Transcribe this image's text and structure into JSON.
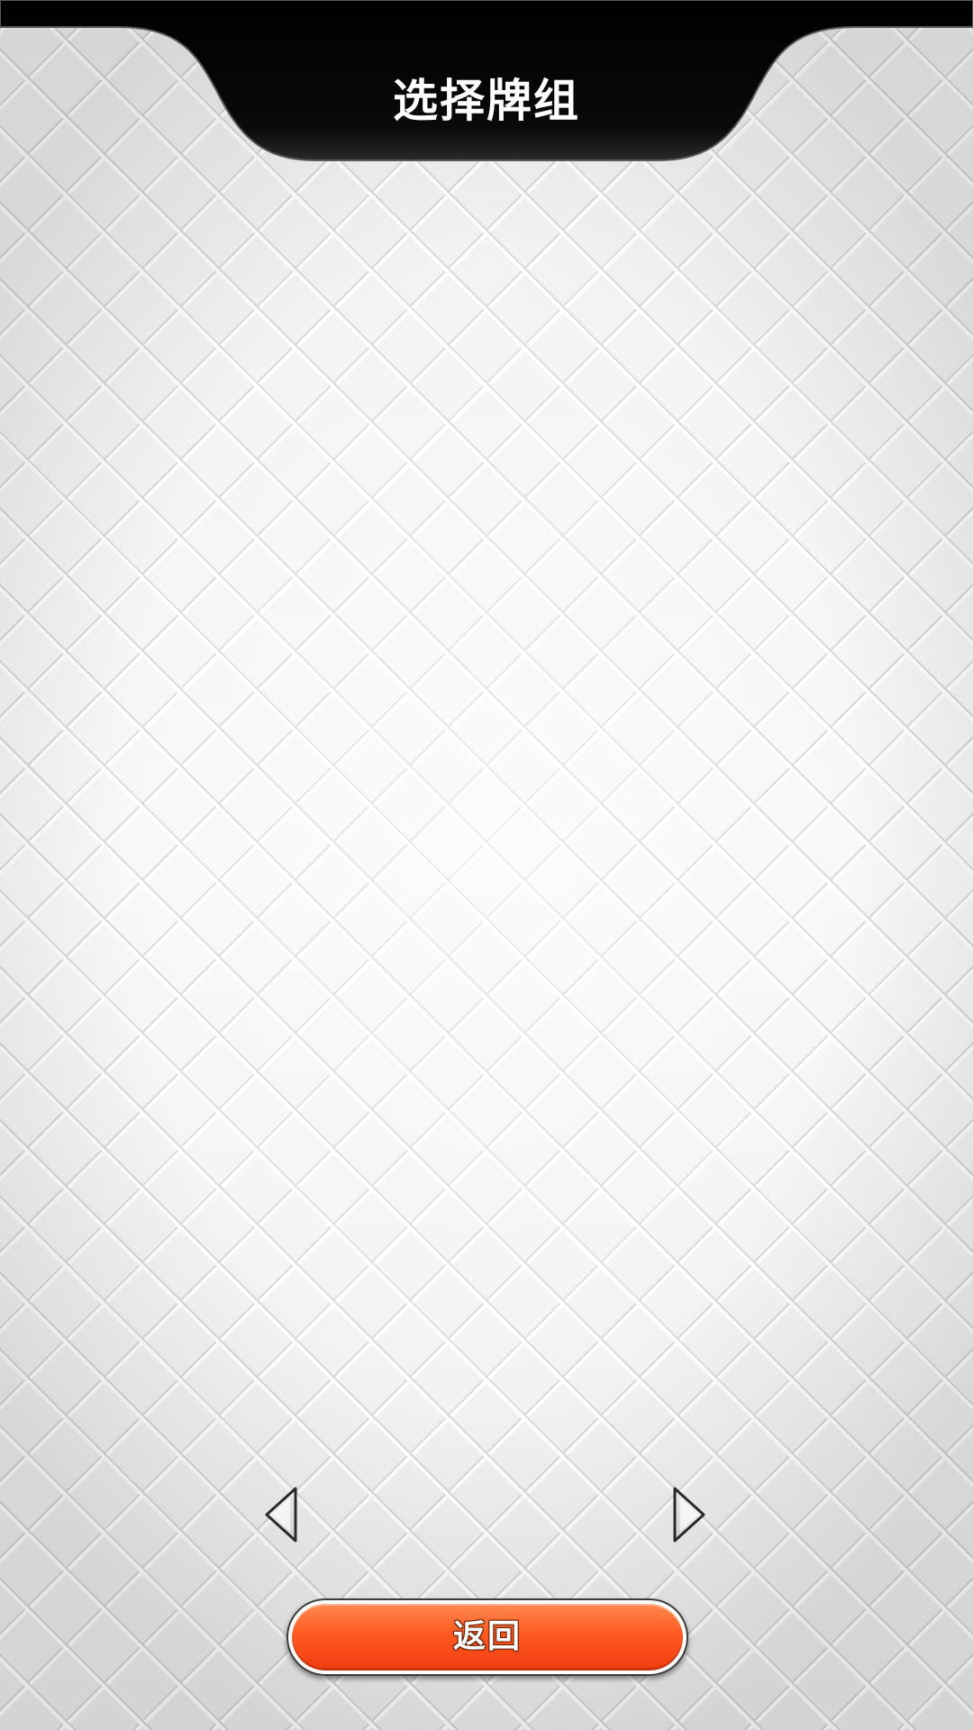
{
  "header": {
    "title": "选择牌组",
    "background_color": "#000000"
  },
  "carousel": {
    "prev_icon": "arrow-left-icon",
    "next_icon": "arrow-right-icon"
  },
  "footer": {
    "back_label": "返回",
    "back_color": "#ff5a22"
  },
  "background": {
    "pattern": "quilted-diamond",
    "base_color": "#f3f3f3"
  }
}
